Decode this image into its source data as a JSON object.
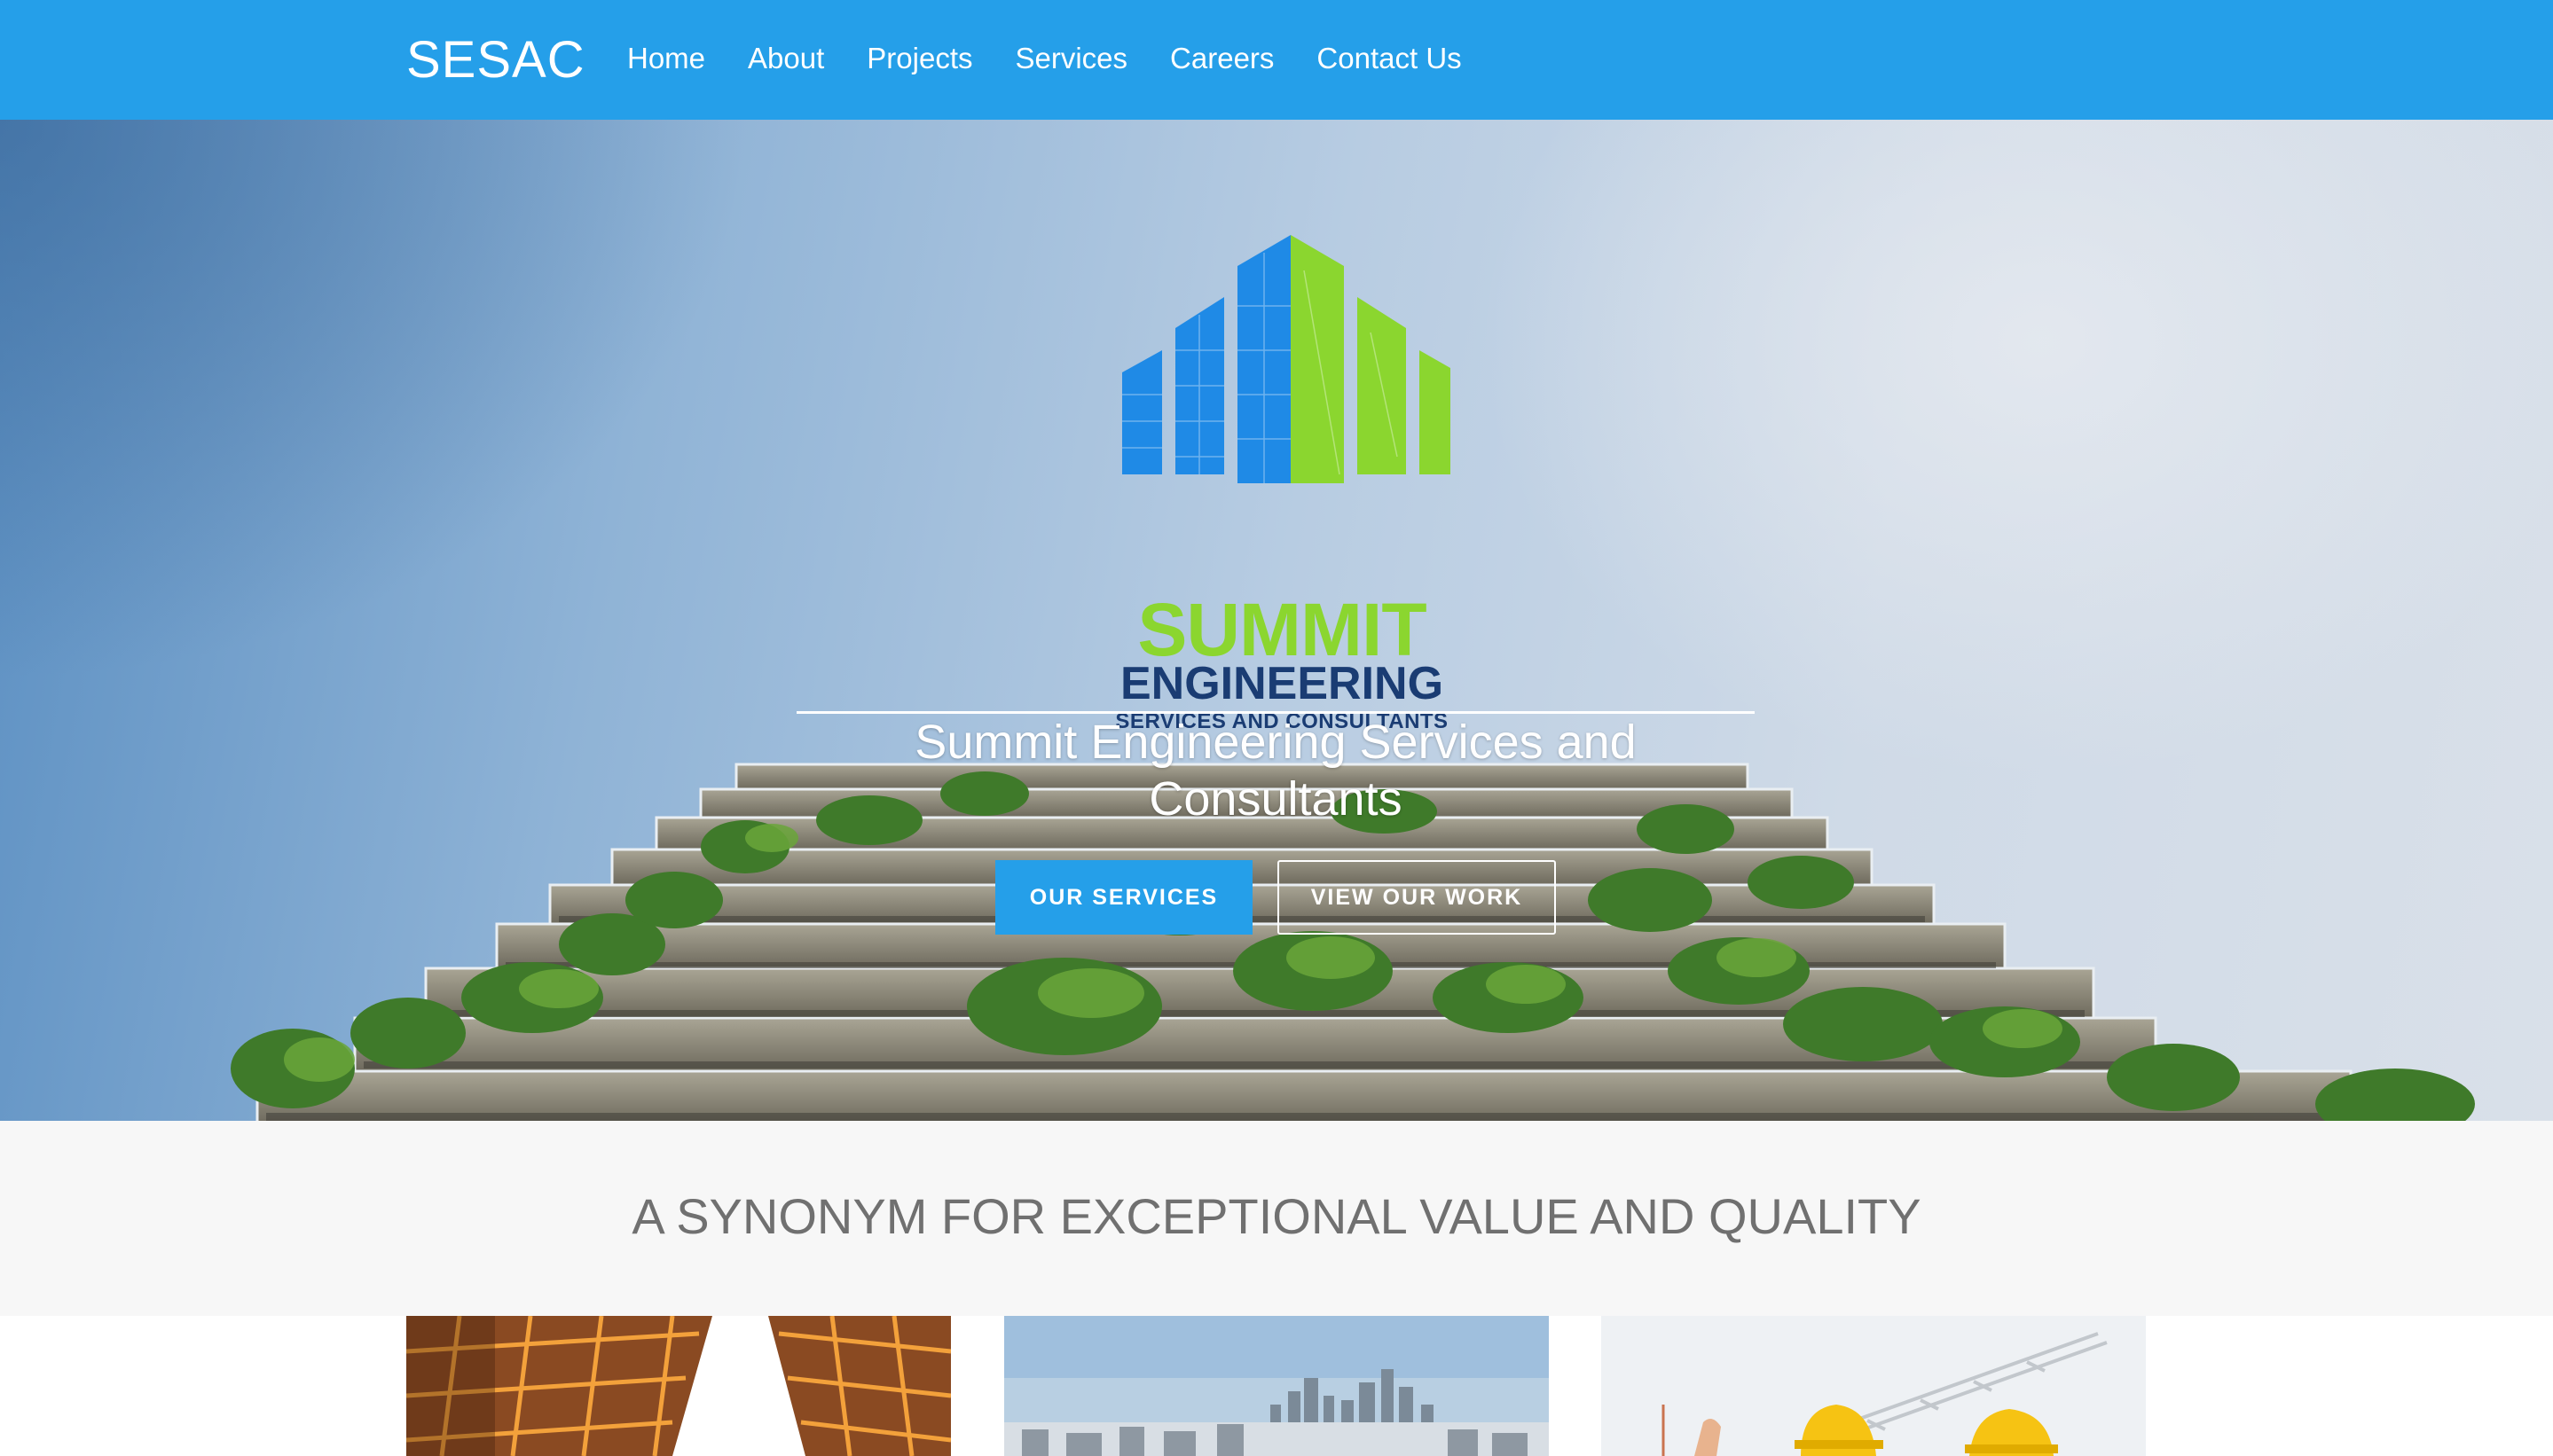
{
  "navbar": {
    "brand": "SESAC",
    "links": [
      "Home",
      "About",
      "Projects",
      "Services",
      "Careers",
      "Contact Us"
    ],
    "background_color": "#259fe9"
  },
  "hero": {
    "logo": {
      "line1": "SUMMIT",
      "line2": "ENGINEERING",
      "line3": "SERVICES AND CONSULTANTS",
      "colors": {
        "blue": "#1f8ae6",
        "green": "#8bd62f",
        "navy": "#1a3c73"
      }
    },
    "title": "Summit Engineering Services and Consultants",
    "buttons": {
      "primary": "OUR SERVICES",
      "secondary": "VIEW OUR WORK"
    }
  },
  "tagline": "A SYNONYM FOR EXCEPTIONAL VALUE AND QUALITY",
  "cards": [
    {
      "image": "glass-building-photo"
    },
    {
      "image": "city-skyline-photo"
    },
    {
      "image": "construction-workers-photo"
    }
  ]
}
